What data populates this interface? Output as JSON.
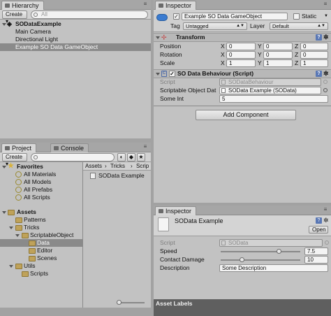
{
  "hierarchy": {
    "tab_label": "Hierarchy",
    "create_label": "Create",
    "search_placeholder": "All",
    "scene_name": "SODataExample",
    "items": [
      "Main Camera",
      "Directional Light",
      "Example SO Data GameObject"
    ]
  },
  "inspector_top": {
    "tab_label": "Inspector",
    "object_name": "Example SO Data GameObject",
    "static_label": "Static",
    "tag_label": "Tag",
    "tag_value": "Untagged",
    "layer_label": "Layer",
    "layer_value": "Default",
    "transform": {
      "title": "Transform",
      "rows": [
        {
          "label": "Position",
          "x": "0",
          "y": "0",
          "z": "0"
        },
        {
          "label": "Rotation",
          "x": "0",
          "y": "0",
          "z": "0"
        },
        {
          "label": "Scale",
          "x": "1",
          "y": "1",
          "z": "1"
        }
      ],
      "axis_x": "X",
      "axis_y": "Y",
      "axis_z": "Z"
    },
    "so_behaviour": {
      "title": "SO Data Behaviour (Script)",
      "script_label": "Script",
      "script_value": "SODataBehaviour",
      "so_label": "Scriptable Object Dat",
      "so_value": "SOData Example (SOData)",
      "some_int_label": "Some Int",
      "some_int_value": "5"
    },
    "add_component_label": "Add Component"
  },
  "project": {
    "tab_label": "Project",
    "console_tab_label": "Console",
    "create_label": "Create",
    "favorites_label": "Favorites",
    "favorites": [
      "All Materials",
      "All Models",
      "All Prefabs",
      "All Scripts"
    ],
    "assets_label": "Assets",
    "tree": [
      {
        "label": "Patterns",
        "depth": 1
      },
      {
        "label": "Tricks",
        "depth": 1
      },
      {
        "label": "ScriptableObject",
        "depth": 2
      },
      {
        "label": "Data",
        "depth": 3
      },
      {
        "label": "Editor",
        "depth": 3
      },
      {
        "label": "Scenes",
        "depth": 3
      },
      {
        "label": "Utils",
        "depth": 1
      },
      {
        "label": "Scripts",
        "depth": 2
      }
    ],
    "breadcrumb": [
      "Assets",
      "Tricks",
      "Scrip"
    ],
    "file_item": "SOData Example"
  },
  "inspector_bottom": {
    "tab_label": "Inspector",
    "asset_name": "SOData Example",
    "open_label": "Open",
    "script_label": "Script",
    "script_value": "SOData",
    "speed_label": "Speed",
    "speed_value": "7.5",
    "speed_fraction": 0.75,
    "contact_label": "Contact Damage",
    "contact_value": "10",
    "contact_fraction": 0.25,
    "description_label": "Description",
    "description_value": "Some Description",
    "asset_labels": "Asset Labels"
  }
}
